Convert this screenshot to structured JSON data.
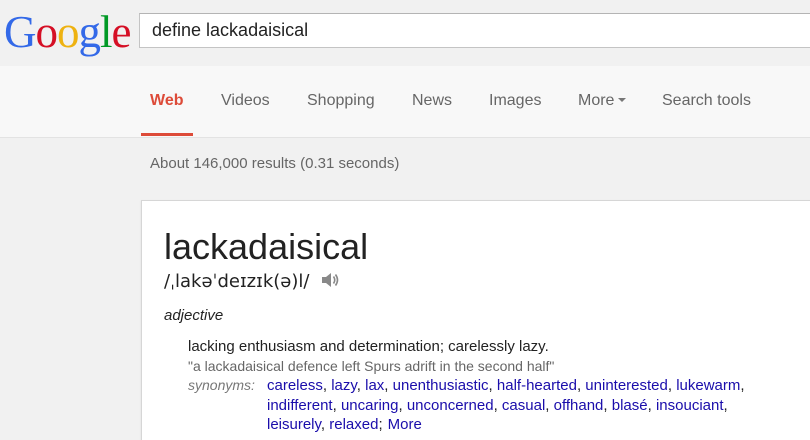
{
  "logo": {
    "letters": [
      "G",
      "o",
      "o",
      "g",
      "l",
      "e"
    ],
    "colors": [
      "#3369e8",
      "#d50f25",
      "#eeb211",
      "#3369e8",
      "#009925",
      "#d50f25"
    ]
  },
  "search": {
    "value": "define lackadaisical"
  },
  "nav": {
    "tabs": [
      "Web",
      "Videos",
      "Shopping",
      "News",
      "Images",
      "More",
      "Search tools"
    ],
    "active_color": "#dd4b39"
  },
  "results_stats": "About 146,000 results (0.31 seconds)",
  "dictionary": {
    "word": "lackadaisical",
    "pronunciation": "/ˌlakəˈdeɪzɪk(ə)l/",
    "speaker_icon": "speaker-icon",
    "part_of_speech": "adjective",
    "definition": "lacking enthusiasm and determination; carelessly lazy.",
    "example": "\"a lackadaisical defence left Spurs adrift in the second half\"",
    "synonyms_label": "synonyms:",
    "synonyms": [
      "careless",
      "lazy",
      "lax",
      "unenthusiastic",
      "half-hearted",
      "uninterested",
      "lukewarm",
      "indifferent",
      "uncaring",
      "unconcerned",
      "casual",
      "offhand",
      "blasé",
      "insouciant",
      "leisurely",
      "relaxed"
    ],
    "more_label": "More",
    "link_color": "#1a0dab"
  }
}
